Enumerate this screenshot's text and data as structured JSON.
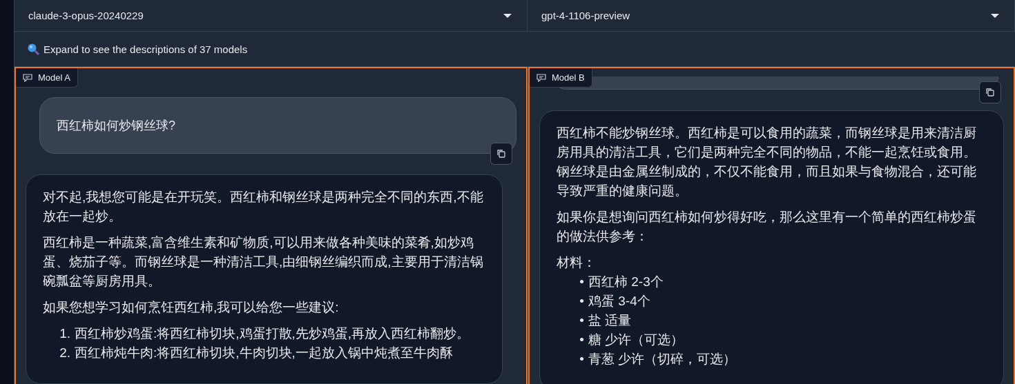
{
  "model_selectors": [
    {
      "value": "claude-3-opus-20240229"
    },
    {
      "value": "gpt-4-1106-preview"
    }
  ],
  "accordion": {
    "label": "Expand to see the descriptions of 37 models"
  },
  "panels": [
    {
      "label": "Model A",
      "user_message": "西红柿如何炒钢丝球?",
      "show_prev_edge": false,
      "reply": [
        {
          "kind": "paragraph",
          "text": "对不起,我想您可能是在开玩笑。西红柿和钢丝球是两种完全不同的东西,不能放在一起炒。"
        },
        {
          "kind": "paragraph",
          "text": "西红柿是一种蔬菜,富含维生素和矿物质,可以用来做各种美味的菜肴,如炒鸡蛋、烧茄子等。而钢丝球是一种清洁工具,由细钢丝编织而成,主要用于清洁锅碗瓢盆等厨房用具。"
        },
        {
          "kind": "paragraph",
          "text": "如果您想学习如何烹饪西红柿,我可以给您一些建议:"
        },
        {
          "kind": "list",
          "items": [
            {
              "marker": "1.",
              "text": "西红柿炒鸡蛋:将西红柿切块,鸡蛋打散,先炒鸡蛋,再放入西红柿翻炒。"
            },
            {
              "marker": "2.",
              "text": "西红柿炖牛肉:将西红柿切块,牛肉切块,一起放入锅中炖煮至牛肉酥"
            }
          ]
        }
      ]
    },
    {
      "label": "Model B",
      "show_prev_edge": true,
      "reply": [
        {
          "kind": "paragraph",
          "text": "西红柿不能炒钢丝球。西红柿是可以食用的蔬菜，而钢丝球是用来清洁厨房用具的清洁工具，它们是两种完全不同的物品，不能一起烹饪或食用。钢丝球是由金属丝制成的，不仅不能食用，而且如果与食物混合，还可能导致严重的健康问题。"
        },
        {
          "kind": "paragraph",
          "text": "如果你是想询问西红柿如何炒得好吃，那么这里有一个简单的西红柿炒蛋的做法供参考："
        },
        {
          "kind": "heading",
          "text": "材料："
        },
        {
          "kind": "list",
          "items": [
            {
              "marker": "•",
              "text": "西红柿 2-3个"
            },
            {
              "marker": "•",
              "text": "鸡蛋 3-4个"
            },
            {
              "marker": "•",
              "text": "盐 适量"
            },
            {
              "marker": "•",
              "text": "糖 少许（可选）"
            },
            {
              "marker": "•",
              "text": "青葱 少许（切碎，可选）"
            }
          ]
        }
      ]
    }
  ]
}
